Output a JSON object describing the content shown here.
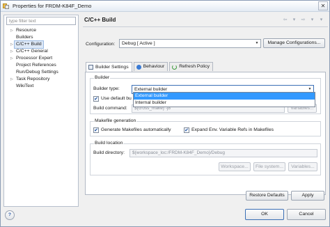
{
  "window": {
    "title": "Properties for FRDM-K84F_Demo",
    "close_symbol": "✕"
  },
  "sidebar": {
    "filter_placeholder": "type filter text",
    "items": [
      {
        "label": "Resource",
        "has_children": true
      },
      {
        "label": "Builders",
        "has_children": false
      },
      {
        "label": "C/C++ Build",
        "has_children": true,
        "selected": true
      },
      {
        "label": "C/C++ General",
        "has_children": true
      },
      {
        "label": "Processor Expert",
        "has_children": true
      },
      {
        "label": "Project References",
        "has_children": false
      },
      {
        "label": "Run/Debug Settings",
        "has_children": false
      },
      {
        "label": "Task Repository",
        "has_children": true
      },
      {
        "label": "WikiText",
        "has_children": false
      }
    ]
  },
  "page": {
    "title": "C/C++ Build",
    "nav": {
      "back": "⇦",
      "back_menu": "▾",
      "forward": "⇨",
      "forward_menu": "▾",
      "menu": "▾"
    }
  },
  "configuration": {
    "label": "Configuration:",
    "value": "Debug  [ Active ]",
    "manage_button": "Manage Configurations..."
  },
  "tabs": [
    {
      "label": "Builder Settings",
      "icon": "settings-icon",
      "active": true
    },
    {
      "label": "Behaviour",
      "icon": "behaviour-icon",
      "active": false
    },
    {
      "label": "Refresh Policy",
      "icon": "refresh-icon",
      "active": false
    }
  ],
  "builder": {
    "group_title": "Builder",
    "type_label": "Builder type:",
    "type_value": "External builder",
    "dropdown_options": [
      "External builder",
      "Internal builder"
    ],
    "use_default_label": "Use default bu",
    "use_default_checked": true,
    "command_label": "Build command:",
    "command_value": "${cross_make} -j8",
    "variables_button": "Variables..."
  },
  "makefile": {
    "group_title": "Makefile generation",
    "generate_label": "Generate Makefiles automatically",
    "generate_checked": true,
    "expand_label": "Expand Env. Variable Refs in Makefiles",
    "expand_checked": true
  },
  "location": {
    "group_title": "Build location",
    "dir_label": "Build directory:",
    "dir_value": "${workspace_loc:/FRDM-K84F_Demo}/Debug",
    "workspace_button": "Workspace...",
    "filesystem_button": "File system...",
    "variables_button": "Variables..."
  },
  "footer": {
    "restore_button": "Restore Defaults",
    "apply_button": "Apply",
    "ok_button": "OK",
    "cancel_button": "Cancel",
    "help_symbol": "?"
  },
  "colors": {
    "selection": "#3399ff",
    "tree_selection": "#dde8f6"
  }
}
